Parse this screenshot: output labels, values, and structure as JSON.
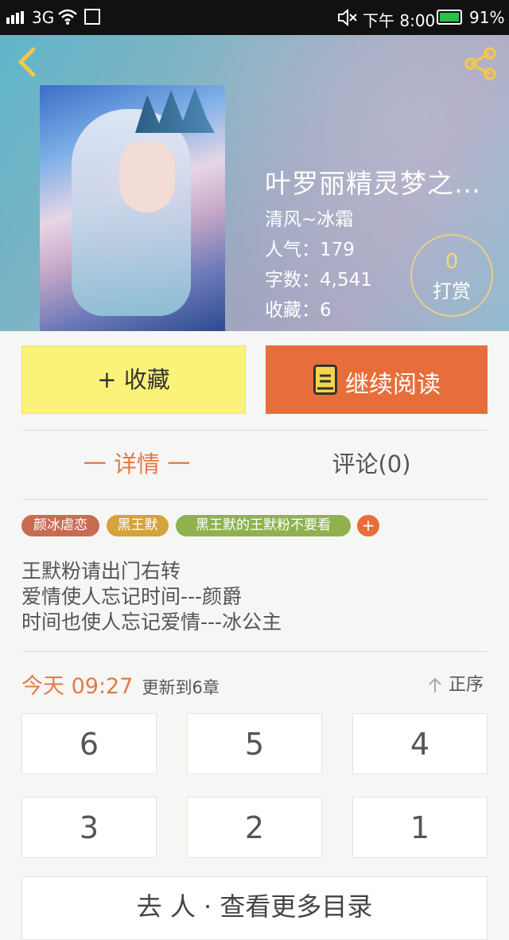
{
  "status_bar": {
    "network": "3G",
    "time": "下午 8:00",
    "battery": "91%"
  },
  "book": {
    "title": "叶罗丽精灵梦之…",
    "author": "清风~冰霜",
    "popularity": "人气：179",
    "words": "字数：4,541",
    "favorites": "收藏：6",
    "tip_count": "0",
    "tip_label": "打赏"
  },
  "actions": {
    "favorite": "+ 收藏",
    "continue_reading": "继续阅读"
  },
  "tabs": {
    "detail": "一 详情 一",
    "comments": "评论(0)"
  },
  "tags": [
    {
      "label": "颜冰虐恋",
      "color": "#c96b52"
    },
    {
      "label": "黑王默",
      "color": "#d4a33b"
    },
    {
      "label": "黑王默的王默粉不要看",
      "color": "#8fb24f"
    }
  ],
  "tag_add": "+",
  "description": [
    "王默粉请出门右转",
    "爱情使人忘记时间---颜爵",
    "时间也使人忘记爱情---冰公主"
  ],
  "update": {
    "time": "今天 09:27",
    "text": "更新到6章",
    "order": "正序"
  },
  "chapters": [
    "6",
    "5",
    "4",
    "3",
    "2",
    "1"
  ],
  "more_button": "去 人 · 查看更多目录"
}
